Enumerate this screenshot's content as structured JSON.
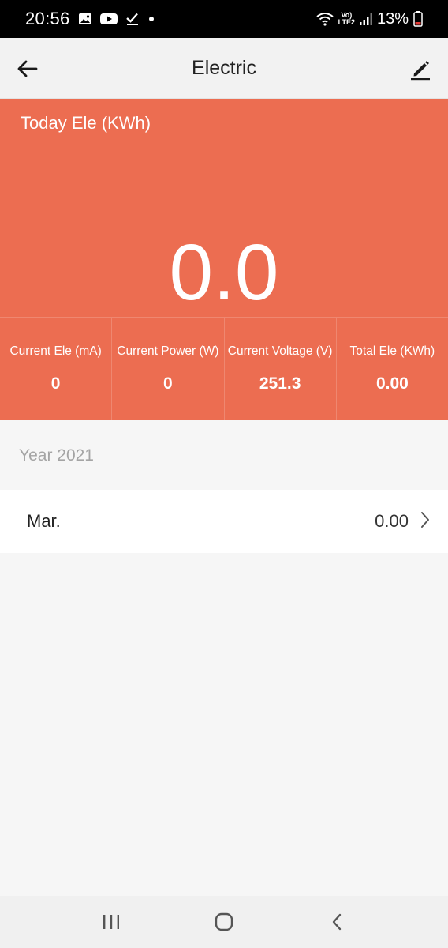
{
  "status_bar": {
    "time": "20:56",
    "battery_percent": "13%",
    "network_label_top": "Vo)",
    "network_label_bottom": "LTE2",
    "icons": [
      "gallery-icon",
      "youtube-icon",
      "check-icon",
      "dot-icon",
      "wifi-icon",
      "signal-icon",
      "battery-icon"
    ]
  },
  "app_bar": {
    "title": "Electric",
    "back_icon": "arrow-left-icon",
    "edit_icon": "pencil-icon"
  },
  "hero": {
    "today_label": "Today Ele (KWh)",
    "today_value": "0.0",
    "background_color": "#ec6d51",
    "stats": [
      {
        "label": "Current Ele (mA)",
        "value": "0"
      },
      {
        "label": "Current Power (W)",
        "value": "0"
      },
      {
        "label": "Current Voltage (V)",
        "value": "251.3"
      },
      {
        "label": "Total Ele (KWh)",
        "value": "0.00"
      }
    ]
  },
  "history": {
    "year_label": "Year 2021",
    "months": [
      {
        "label": "Mar.",
        "value": "0.00"
      }
    ]
  },
  "nav_bar": {
    "buttons": [
      "recents-icon",
      "home-icon",
      "back-icon"
    ]
  }
}
